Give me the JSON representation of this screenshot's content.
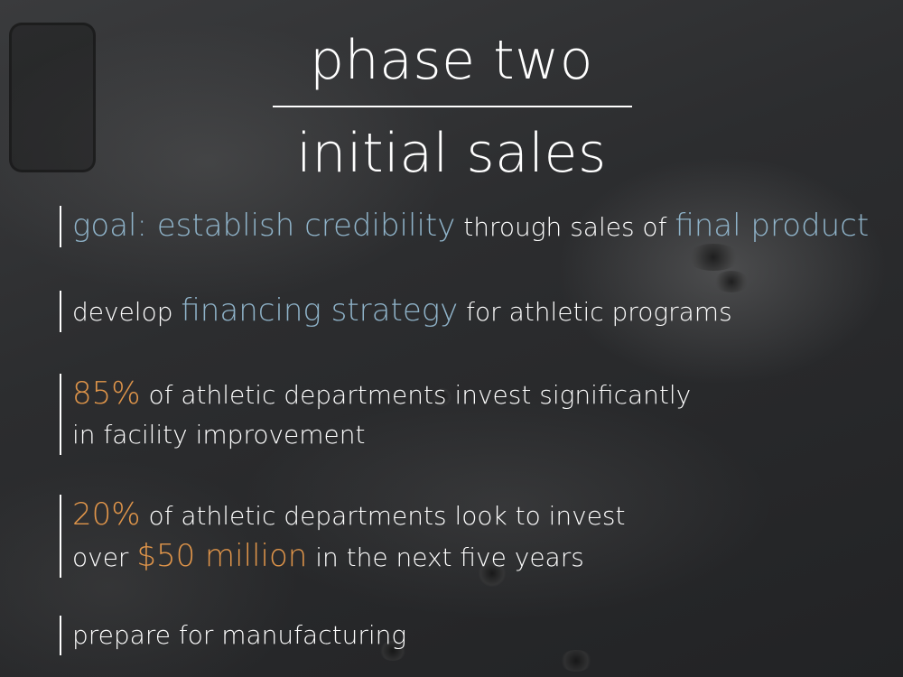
{
  "slide": {
    "title_line1": "phase two",
    "title_line2": "initial sales",
    "items": [
      {
        "highlight1": "goal: establish credibility",
        "text1": " through sales of ",
        "highlight2": "final product"
      },
      {
        "text1": "develop ",
        "highlight1": "financing strategy",
        "text2": " for athletic programs"
      },
      {
        "highlight1": "85%",
        "text1": " of athletic departments invest significantly",
        "line2": "in facility improvement"
      },
      {
        "highlight1": "20%",
        "text1": " of athletic departments look to invest",
        "line2_text1": "over ",
        "line2_highlight": "$50 million",
        "line2_text2": " in the next five years"
      },
      {
        "text1": "prepare for manufacturing"
      }
    ]
  },
  "colors": {
    "accent_blue": "#8fb3c9",
    "accent_orange": "#e0954a",
    "text": "#ffffff"
  }
}
